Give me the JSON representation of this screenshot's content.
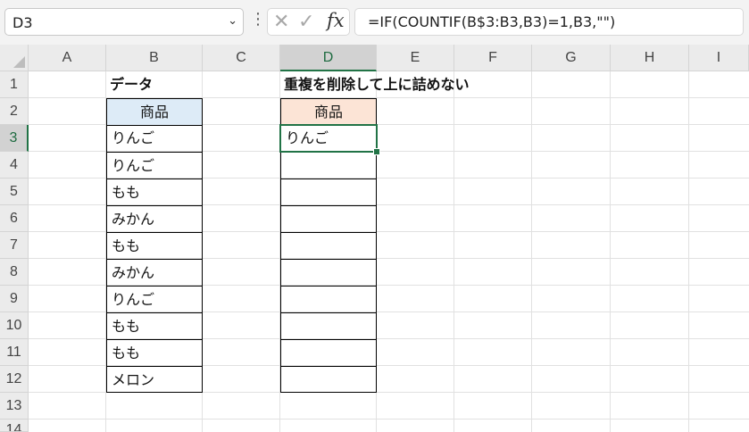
{
  "name_box": {
    "value": "D3"
  },
  "formula_bar": {
    "formula": "=IF(COUNTIF(B$3:B3,B3)=1,B3,\"\")"
  },
  "columns": [
    "A",
    "B",
    "C",
    "D",
    "E",
    "F",
    "G",
    "H",
    "I"
  ],
  "rows": [
    "1",
    "2",
    "3",
    "4",
    "5",
    "6",
    "7",
    "8",
    "9",
    "10",
    "11",
    "12",
    "13",
    "14"
  ],
  "selected_column": "D",
  "selected_row": "3",
  "cells": {
    "B1": "データ",
    "B2": "商品",
    "B3": "りんご",
    "B4": "りんご",
    "B5": "もも",
    "B6": "みかん",
    "B7": "もも",
    "B8": "みかん",
    "B9": "りんご",
    "B10": "もも",
    "B11": "もも",
    "B12": "メロン",
    "D1": "重複を削除して上に詰めない",
    "D2": "商品",
    "D3": "りんご"
  },
  "colors": {
    "accent": "#217346",
    "header_blue": "#ddebf7",
    "header_orange": "#fce4d6"
  }
}
